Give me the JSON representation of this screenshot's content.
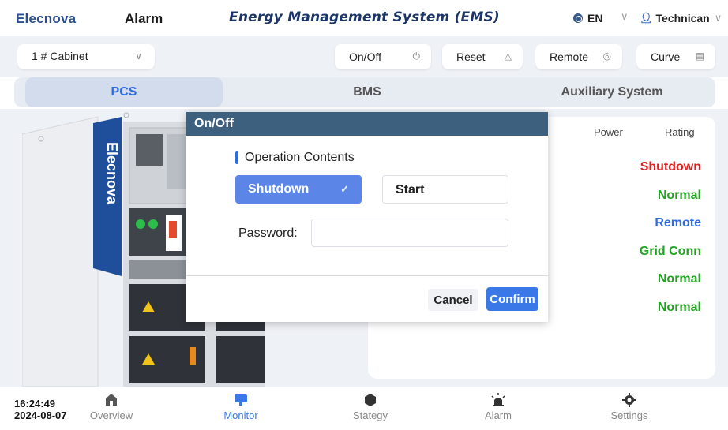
{
  "header": {
    "brand": "Elecnova",
    "alarm_label": "Alarm",
    "title": "Energy Management System (EMS)",
    "language": "EN",
    "user": "Technican"
  },
  "control_bar": {
    "cabinet_select": "1 # Cabinet",
    "buttons": [
      {
        "label": "On/Off",
        "icon": "power-icon"
      },
      {
        "label": "Reset",
        "icon": "warning-icon"
      },
      {
        "label": "Remote",
        "icon": "target-icon"
      },
      {
        "label": "Curve",
        "icon": "chart-icon"
      }
    ]
  },
  "tabs": [
    {
      "label": "PCS",
      "active": true
    },
    {
      "label": "BMS",
      "active": false
    },
    {
      "label": "Auxiliary System",
      "active": false
    }
  ],
  "cabinet_image": {
    "logo_text": "Elecnova"
  },
  "rating_panel": {
    "col_power": "Power",
    "col_rating": "Rating",
    "values": [
      {
        "text": "Shutdown",
        "color": "#e02020"
      },
      {
        "text": "Normal",
        "color": "#21a321"
      },
      {
        "text": "Remote",
        "color": "#2f6be0"
      },
      {
        "text": "Grid Conn",
        "color": "#21a321"
      },
      {
        "text": "Normal",
        "color": "#21a321"
      },
      {
        "text": "Normal",
        "color": "#21a321"
      }
    ]
  },
  "modal": {
    "title": "On/Off",
    "section_label": "Operation Contents",
    "option_selected": "Shutdown",
    "option_other": "Start",
    "password_label": "Password:",
    "password_value": "",
    "cancel_label": "Cancel",
    "confirm_label": "Confirm"
  },
  "bottom_nav": {
    "time": "16:24:49",
    "date": "2024-08-07",
    "items": [
      {
        "label": "Overview",
        "icon": "home-icon",
        "active": false
      },
      {
        "label": "Monitor",
        "icon": "monitor-icon",
        "active": true
      },
      {
        "label": "Stategy",
        "icon": "strategy-icon",
        "active": false
      },
      {
        "label": "Alarm",
        "icon": "alarm-icon",
        "active": false
      },
      {
        "label": "Settings",
        "icon": "settings-icon",
        "active": false
      }
    ]
  },
  "colors": {
    "accent": "#2f6be0",
    "modal_header": "#3d607e",
    "error": "#e02020",
    "ok": "#21a321"
  }
}
